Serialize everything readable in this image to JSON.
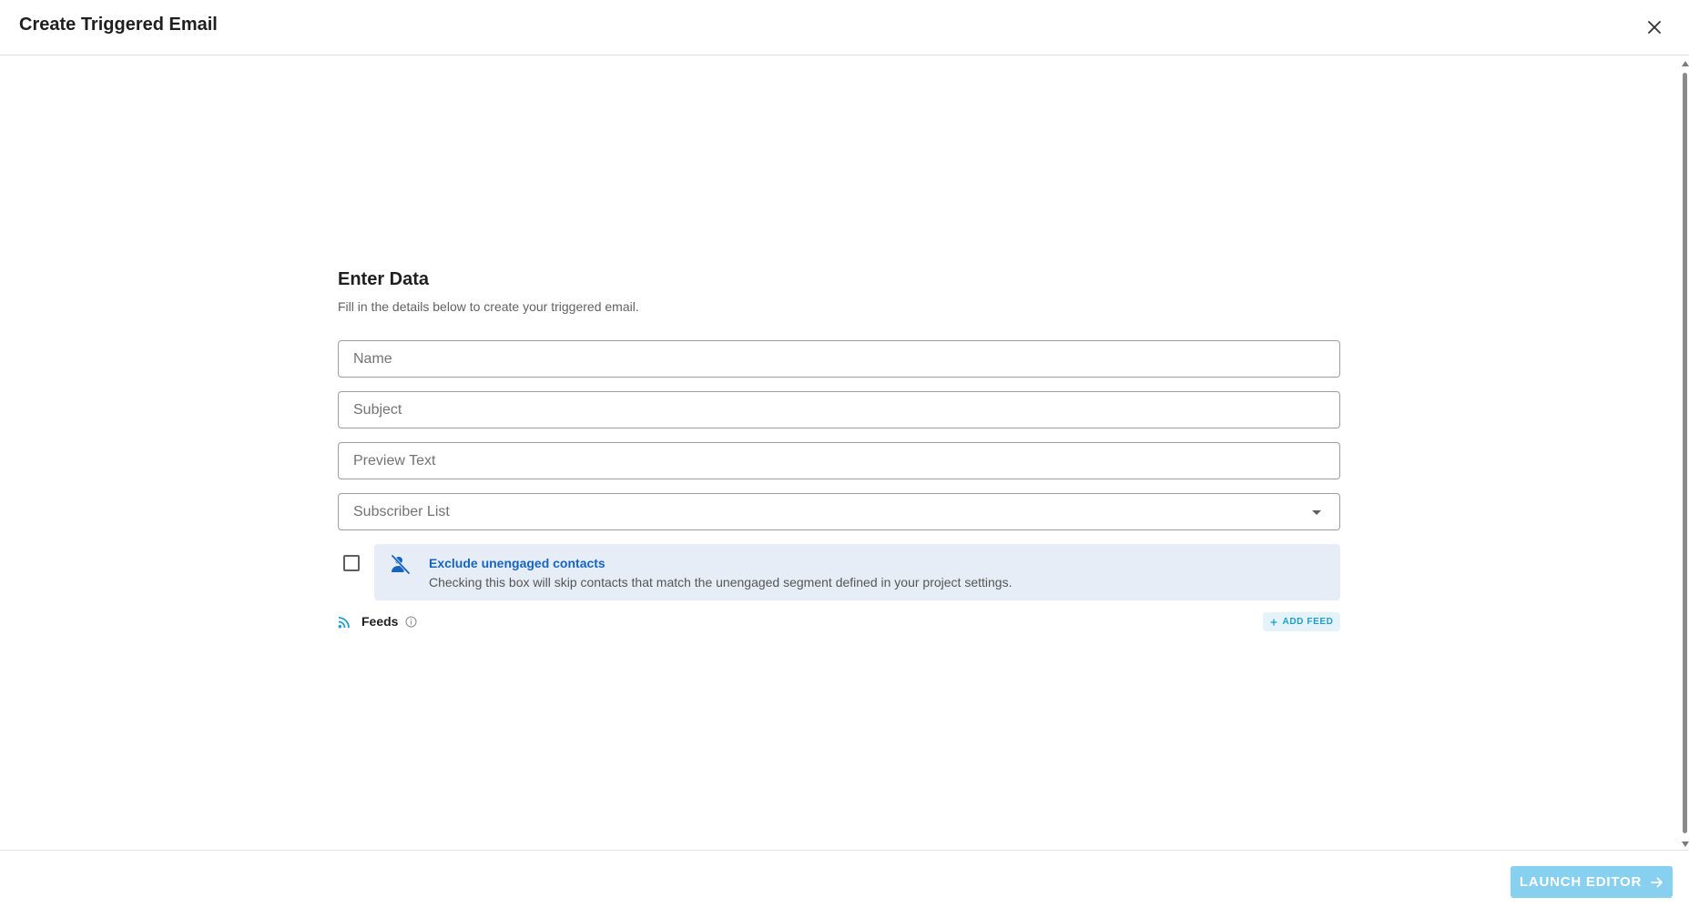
{
  "header": {
    "title": "Create Triggered Email",
    "close_icon": "close-icon"
  },
  "form": {
    "title": "Enter Data",
    "subtitle": "Fill in the details below to create your triggered email.",
    "fields": {
      "name": {
        "value": "",
        "placeholder": "Name"
      },
      "subject": {
        "value": "",
        "placeholder": "Subject"
      },
      "preview_text": {
        "value": "",
        "placeholder": "Preview Text"
      },
      "subscriber_list": {
        "selected": "Subscriber List"
      }
    },
    "exclude_unengaged": {
      "checked": false,
      "icon": "person-off-icon",
      "title": "Exclude unengaged contacts",
      "description": "Checking this box will skip contacts that match the unengaged segment defined in your project settings."
    },
    "feeds": {
      "icon": "rss-feed-icon",
      "label": "Feeds",
      "info_icon": "info-circle-icon",
      "add_button": {
        "icon": "plus-icon",
        "label": "ADD FEED"
      }
    }
  },
  "footer": {
    "launch_button": {
      "label": "LAUNCH EDITOR",
      "icon": "arrow-right-icon"
    }
  },
  "colors": {
    "accent": "#1e9cd1",
    "launch_button_bg": "#87d0f0",
    "info_box_bg": "#e7edf7",
    "info_title": "#1565c0"
  }
}
